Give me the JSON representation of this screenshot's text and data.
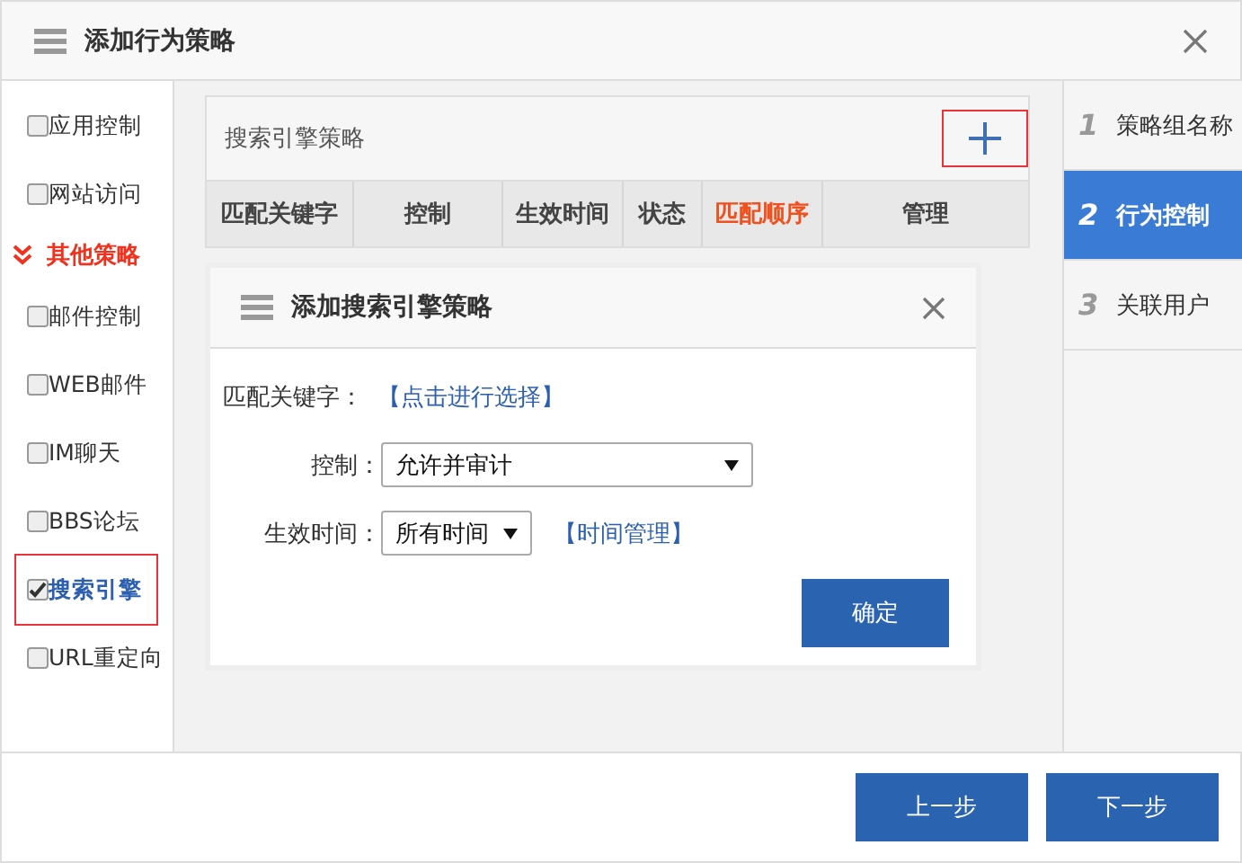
{
  "window": {
    "title": "添加行为策略"
  },
  "sidebar": {
    "items": [
      {
        "kind": "check",
        "label": "应用控制",
        "checked": false,
        "highlighted": false
      },
      {
        "kind": "check",
        "label": "网站访问",
        "checked": false,
        "highlighted": false
      },
      {
        "kind": "group",
        "label": "其他策略",
        "expanded": true
      },
      {
        "kind": "check",
        "label": "邮件控制",
        "checked": false,
        "highlighted": false
      },
      {
        "kind": "check",
        "label": "WEB邮件",
        "checked": false,
        "highlighted": false
      },
      {
        "kind": "check",
        "label": "IM聊天",
        "checked": false,
        "highlighted": false
      },
      {
        "kind": "check",
        "label": "BBS论坛",
        "checked": false,
        "highlighted": false
      },
      {
        "kind": "check",
        "label": "搜索引擎",
        "checked": true,
        "highlighted": true
      },
      {
        "kind": "check",
        "label": "URL重定向",
        "checked": false,
        "highlighted": false
      }
    ]
  },
  "strategy": {
    "title": "搜索引擎策略",
    "add_highlighted": true,
    "columns": [
      {
        "label": "匹配关键字",
        "accent": false
      },
      {
        "label": "控制",
        "accent": false
      },
      {
        "label": "生效时间",
        "accent": false
      },
      {
        "label": "状态",
        "accent": false
      },
      {
        "label": "匹配顺序",
        "accent": true
      },
      {
        "label": "管理",
        "accent": false
      }
    ]
  },
  "dialog": {
    "title": "添加搜索引擎策略",
    "keyword_label": "匹配关键字：",
    "keyword_link": "【点击进行选择】",
    "control_label": "控制：",
    "control_value": "允许并审计",
    "time_label": "生效时间：",
    "time_value": "所有时间",
    "time_link": "【时间管理】",
    "confirm": "确定"
  },
  "steps": [
    {
      "number": "1",
      "label": "策略组名称",
      "selected": false
    },
    {
      "number": "2",
      "label": "行为控制",
      "selected": true
    },
    {
      "number": "3",
      "label": "关联用户",
      "selected": false
    }
  ],
  "buttons": [
    "上一步",
    "下一步"
  ]
}
